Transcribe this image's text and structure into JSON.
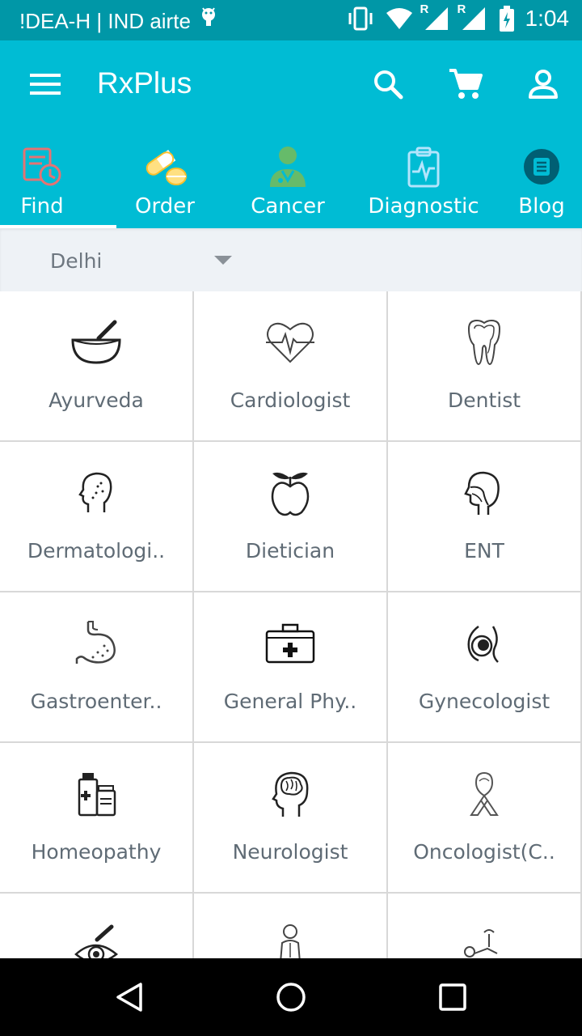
{
  "status_bar": {
    "carrier": "!DEA-H | IND airte",
    "time": "1:04",
    "signal_badge_1": "R",
    "signal_badge_2": "R"
  },
  "toolbar": {
    "title": "RxPlus",
    "icons": [
      "menu-icon",
      "search-icon",
      "cart-icon",
      "account-icon"
    ]
  },
  "tabs": [
    {
      "label": "Find",
      "icon": "find-doctor-icon",
      "selected": true
    },
    {
      "label": "Order",
      "icon": "pills-icon",
      "selected": false
    },
    {
      "label": "Cancer",
      "icon": "doctor-icon",
      "selected": false
    },
    {
      "label": "Diagnostic",
      "icon": "clipboard-ecg-icon",
      "selected": false
    },
    {
      "label": "Blog",
      "icon": "blog-icon",
      "selected": false
    }
  ],
  "city": {
    "value": "Delhi"
  },
  "specialities": [
    {
      "label": "Ayurveda",
      "icon": "mortar-pestle-icon"
    },
    {
      "label": "Cardiologist",
      "icon": "heart-pulse-icon"
    },
    {
      "label": "Dentist",
      "icon": "tooth-icon"
    },
    {
      "label": "Dermatologi..",
      "icon": "face-skin-icon"
    },
    {
      "label": "Dietician",
      "icon": "apple-icon"
    },
    {
      "label": "ENT",
      "icon": "head-ent-icon"
    },
    {
      "label": "Gastroenter..",
      "icon": "stomach-icon"
    },
    {
      "label": "General Phy..",
      "icon": "first-aid-kit-icon"
    },
    {
      "label": "Gynecologist",
      "icon": "pregnancy-icon"
    },
    {
      "label": "Homeopathy",
      "icon": "medicine-bottles-icon"
    },
    {
      "label": "Neurologist",
      "icon": "brain-head-icon"
    },
    {
      "label": "Oncologist(C..",
      "icon": "ribbon-icon"
    },
    {
      "label": "",
      "icon": "eye-dropper-icon"
    },
    {
      "label": "",
      "icon": "person-icon"
    },
    {
      "label": "",
      "icon": "physiotherapy-icon"
    }
  ],
  "colors": {
    "status_bar": "#0097a7",
    "app_bar": "#00bcd4",
    "city_bar": "#eef2f6",
    "label_text": "#5f6b75"
  }
}
